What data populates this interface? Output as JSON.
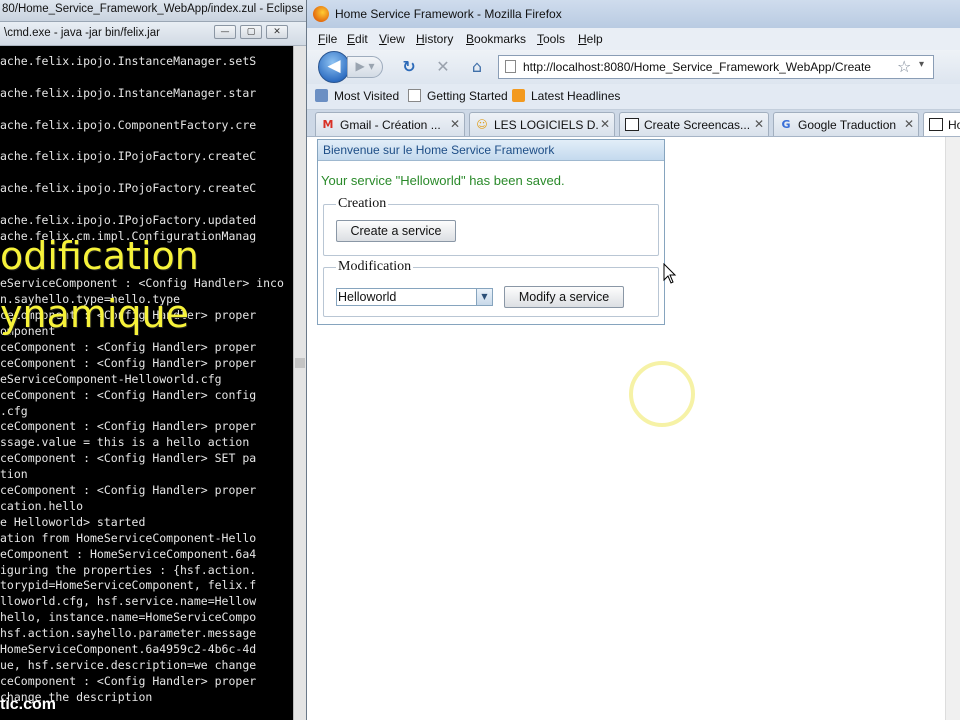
{
  "eclipse": {
    "title": "80/Home_Service_Framework_WebApp/index.zul - Eclipse"
  },
  "cmd": {
    "title": "\\cmd.exe - java -jar bin/felix.jar",
    "lines": [
      "ache.felix.ipojo.InstanceManager.setS",
      "",
      "ache.felix.ipojo.InstanceManager.star",
      "",
      "ache.felix.ipojo.ComponentFactory.cre",
      "",
      "ache.felix.ipojo.IPojoFactory.createC",
      "",
      "ache.felix.ipojo.IPojoFactory.createC",
      "",
      "ache.felix.ipojo.IPojoFactory.updated",
      "ache.felix.cm.impl.ConfigurationManag",
      "",
      "",
      "eServiceComponent : <Config Handler> inco",
      "n.sayhello.type=hello.type",
      "ceComponent : <Config Handler> proper",
      "omponent",
      "ceComponent : <Config Handler> proper",
      "ceComponent : <Config Handler> proper",
      "eServiceComponent-Helloworld.cfg",
      "ceComponent : <Config Handler> config",
      ".cfg",
      "ceComponent : <Config Handler> proper",
      "ssage.value = this is a hello action",
      "ceComponent : <Config Handler> SET pa",
      "tion",
      "ceComponent : <Config Handler> proper",
      "cation.hello",
      "e Helloworld> started",
      "ation from HomeServiceComponent-Hello",
      "eComponent : HomeServiceComponent.6a4",
      "iguring the properties : {hsf.action.",
      "torypid=HomeServiceComponent, felix.f",
      "lloworld.cfg, hsf.service.name=Hellow",
      "hello, instance.name=HomeServiceCompo",
      "hsf.action.sayhello.parameter.message",
      "HomeServiceComponent.6a4959c2-4b6c-4d",
      "ue, hsf.service.description=we change",
      "ceComponent : <Config Handler> proper",
      "change the description"
    ]
  },
  "overlay": {
    "line1": "odification",
    "line2": "ynamique"
  },
  "watermark": "tic.com",
  "firefox": {
    "title": "Home Service Framework - Mozilla Firefox",
    "menu": [
      "File",
      "Edit",
      "View",
      "History",
      "Bookmarks",
      "Tools",
      "Help"
    ],
    "url": "http://localhost:8080/Home_Service_Framework_WebApp/Create",
    "bookmarks": [
      "Most Visited",
      "Getting Started",
      "Latest Headlines"
    ],
    "tabs": [
      {
        "label": "Gmail - Création ...",
        "icon": "M",
        "icon_color": "#d93025"
      },
      {
        "label": "LES LOGICIELS D...",
        "icon": "☺",
        "icon_color": "#e0a020"
      },
      {
        "label": "Create Screencas...",
        "icon": "",
        "icon_color": "#222222"
      },
      {
        "label": "Google Traduction",
        "icon": "G",
        "icon_color": "#3a6fd8"
      },
      {
        "label": "Ho",
        "icon": "",
        "icon_color": "#222222"
      }
    ]
  },
  "hsf": {
    "header": "Bienvenue sur le Home Service Framework",
    "message": "Your service \"Helloworld\" has been saved.",
    "creation_legend": "Creation",
    "create_button": "Create a service",
    "modification_legend": "Modification",
    "selected_service": "Helloworld",
    "modify_button": "Modify a service"
  },
  "colors": {
    "overlay_text": "#f6f23a",
    "success_text": "#2a8a2a",
    "panel_header_text": "#1d4d86"
  }
}
